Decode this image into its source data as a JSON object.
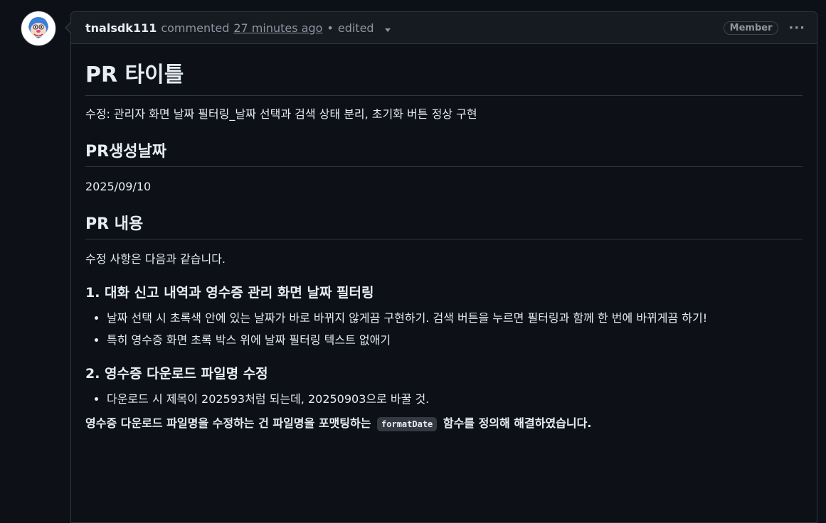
{
  "comment": {
    "author": "tnalsdk111",
    "action": "commented",
    "time": "27 minutes ago",
    "separator": "•",
    "edited": "edited",
    "badge": "Member",
    "menu": "···"
  },
  "content": {
    "title": "PR 타이틀",
    "summary": "수정: 관리자 화면 날짜 필터링_날짜 선택과 검색 상태 분리, 초기화 버튼 정상 구현",
    "date_heading": "PR생성날짜",
    "date": "2025/09/10",
    "content_heading": "PR 내용",
    "intro": "수정 사항은 다음과 같습니다.",
    "section1_heading": "1. 대화 신고 내역과 영수증 관리 화면 날짜 필터링",
    "section1_items": [
      "날짜 선택 시 초록색 안에 있는 날짜가 바로 바뀌지 않게끔 구현하기. 검색 버튼을 누르면 필터링과 함께 한 번에 바뀌게끔 하기!",
      "특히 영수증 화면 초록 박스 위에 날짜 필터링 텍스트 없애기"
    ],
    "section2_heading": "2. 영수증 다운로드 파일명 수정",
    "section2_items": [
      "다운로드 시 제목이 202593처럼 되는데, 20250903으로 바꿀 것."
    ],
    "note_before": "영수증 다운로드 파일명을 수정하는 건 파일명을 포맷팅하는",
    "note_code": "formatDate",
    "note_after": "함수를 정의해 해결하였습니다."
  }
}
